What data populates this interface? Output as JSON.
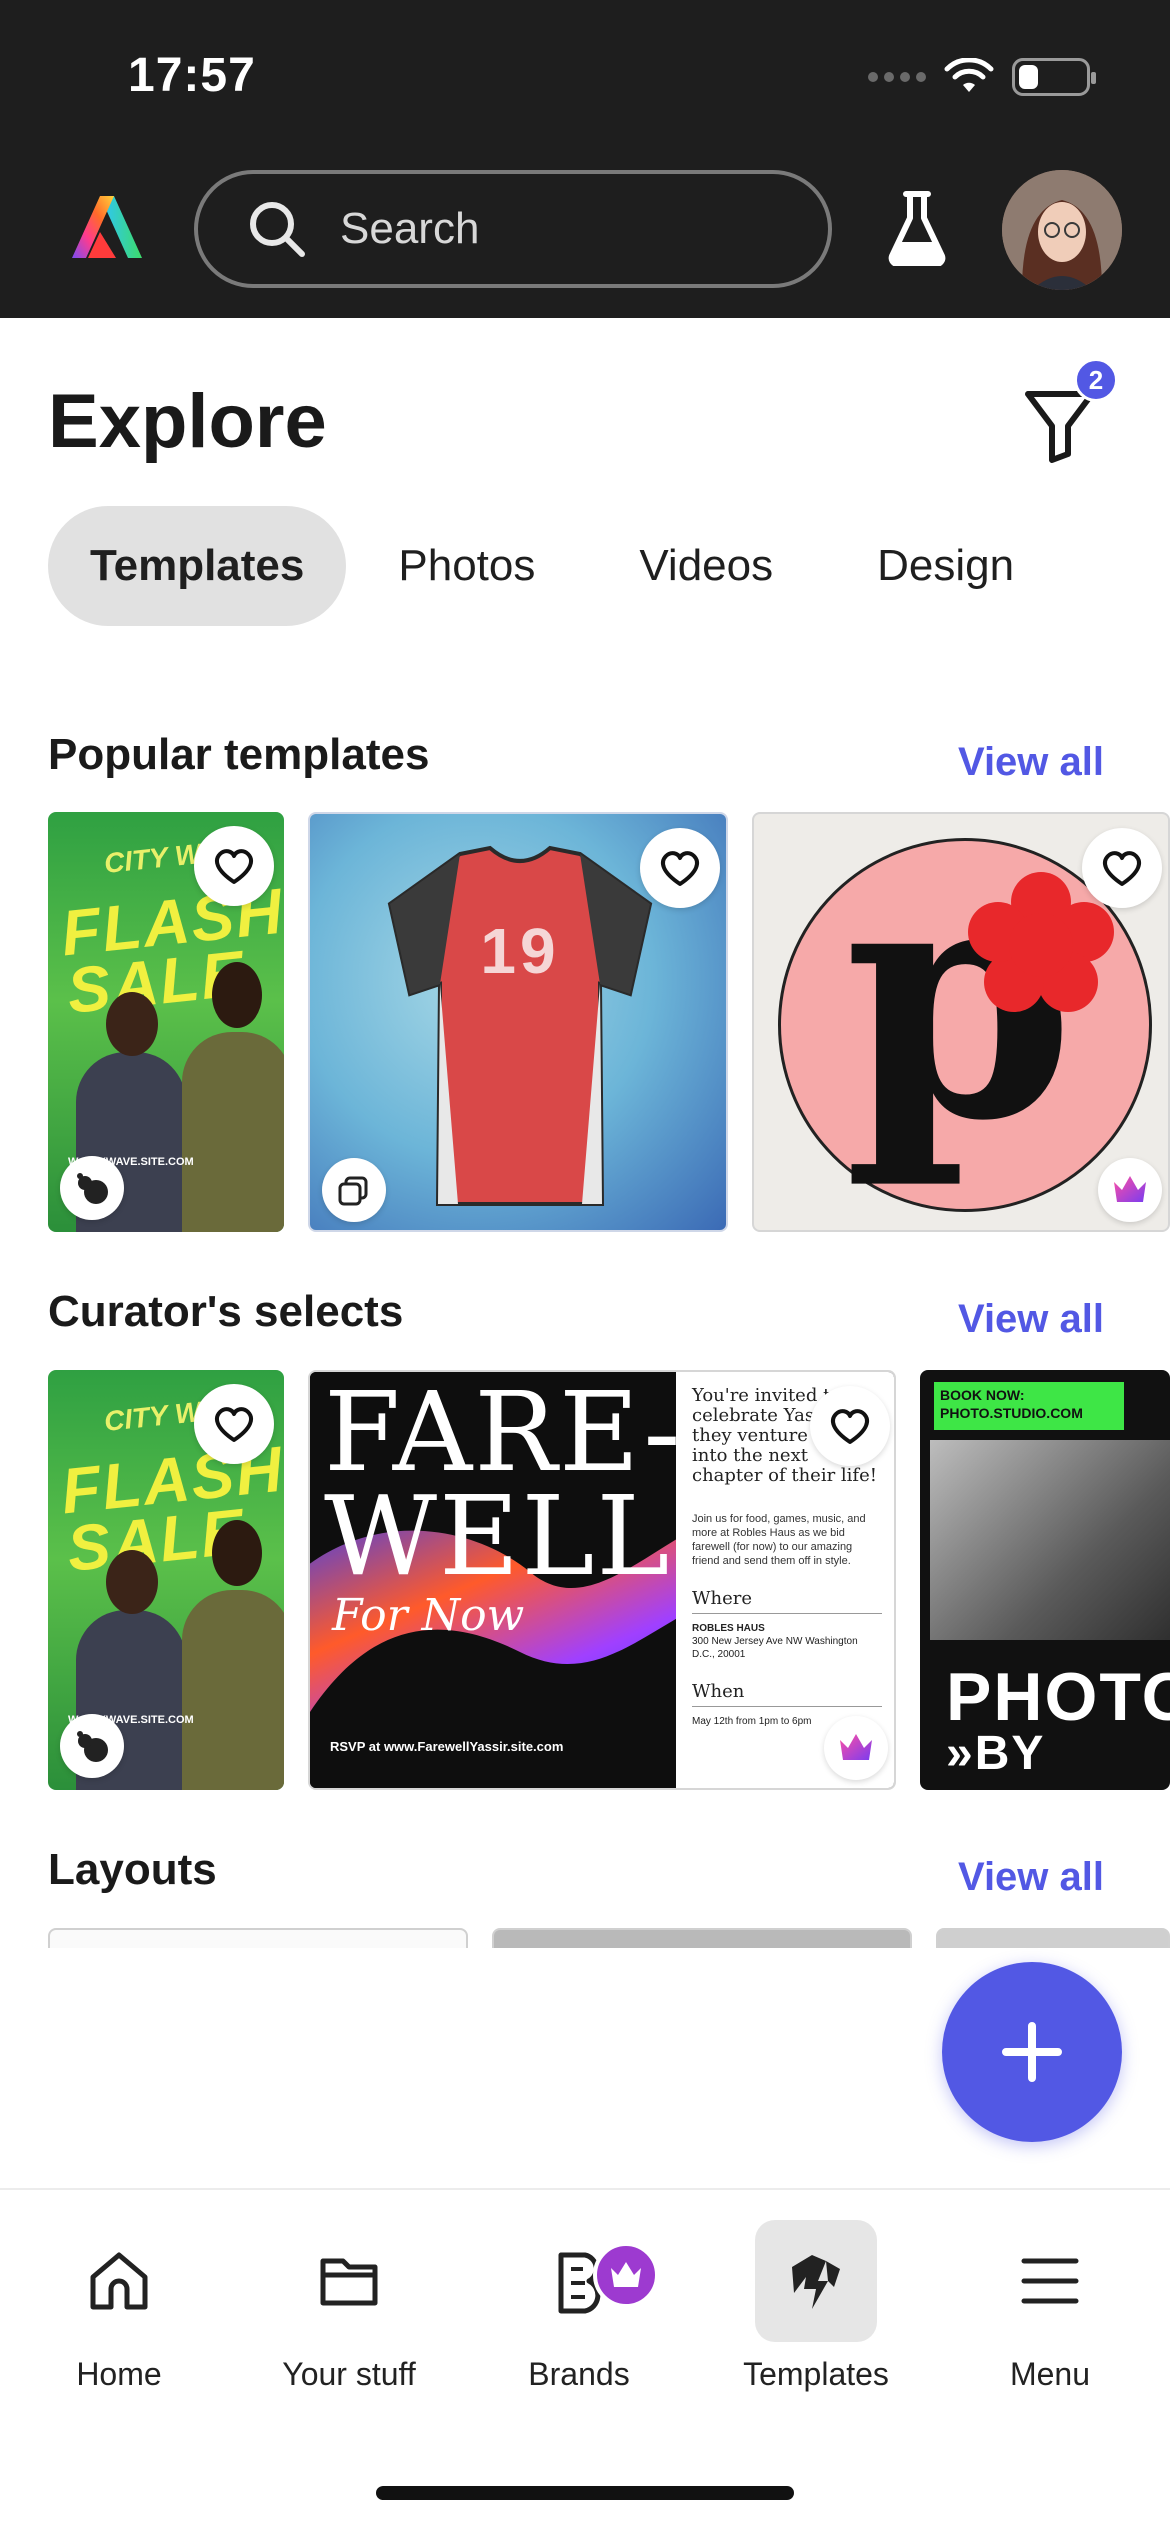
{
  "status_bar": {
    "time": "17:57",
    "battery_percent": 30
  },
  "header": {
    "logo_icon": "adobe-express-logo",
    "search_placeholder": "Search",
    "lab_icon": "beaker-icon",
    "avatar_icon": "user-avatar"
  },
  "explore": {
    "title": "Explore",
    "filter_count": "2",
    "tabs": [
      {
        "label": "Templates",
        "active": true
      },
      {
        "label": "Photos",
        "active": false
      },
      {
        "label": "Videos",
        "active": false
      },
      {
        "label": "Design",
        "active": false
      }
    ]
  },
  "sections": {
    "popular": {
      "title": "Popular templates",
      "view_all": "View all",
      "cards": [
        {
          "art_text_small": "CITY WA",
          "art_text": "FLASH SALE",
          "art_url": "W.CITYWAVE.SITE.COM"
        },
        {
          "art_text": "19"
        },
        {
          "art_text": "p"
        }
      ]
    },
    "curators": {
      "title": "Curator's selects",
      "view_all": "View all",
      "cards": [
        {
          "art_text_small": "CITY WA",
          "art_text": "FLASH SALE",
          "art_url": "W.CITYWAVE.SITE.COM"
        },
        {
          "art_title": "FARE-WELL",
          "art_script": "For Now",
          "art_rsvp": "RSVP at www.FarewellYassir.site.com",
          "art_invite": "You're invited to celebrate Yassir as they venture forth into the next chapter of their life!",
          "art_body": "Join us for food, games, music, and more at Robles Haus as we bid farewell (for now) to our amazing friend and send them off in style.",
          "art_where": "Where",
          "art_venue": "ROBLES HAUS",
          "art_address": "300 New Jersey Ave NW Washington D.C., 20001",
          "art_when": "When",
          "art_time": "May 12th from 1pm to 6pm"
        },
        {
          "art_banner": "BOOK NOW: PHOTO.STUDIO.COM",
          "art_word": "PHOTO",
          "art_by": "»BY GAB"
        }
      ]
    },
    "layouts": {
      "title": "Layouts",
      "view_all": "View all"
    }
  },
  "bottom_nav": [
    {
      "label": "Home",
      "icon": "home-icon",
      "active": false
    },
    {
      "label": "Your stuff",
      "icon": "folder-icon",
      "active": false
    },
    {
      "label": "Brands",
      "icon": "brand-icon",
      "active": false
    },
    {
      "label": "Templates",
      "icon": "templates-icon",
      "active": true
    },
    {
      "label": "Menu",
      "icon": "menu-icon",
      "active": false
    }
  ],
  "colors": {
    "accent": "#5258e4",
    "header_bg": "#1e1e1e",
    "premium": "#9d3ad0"
  }
}
